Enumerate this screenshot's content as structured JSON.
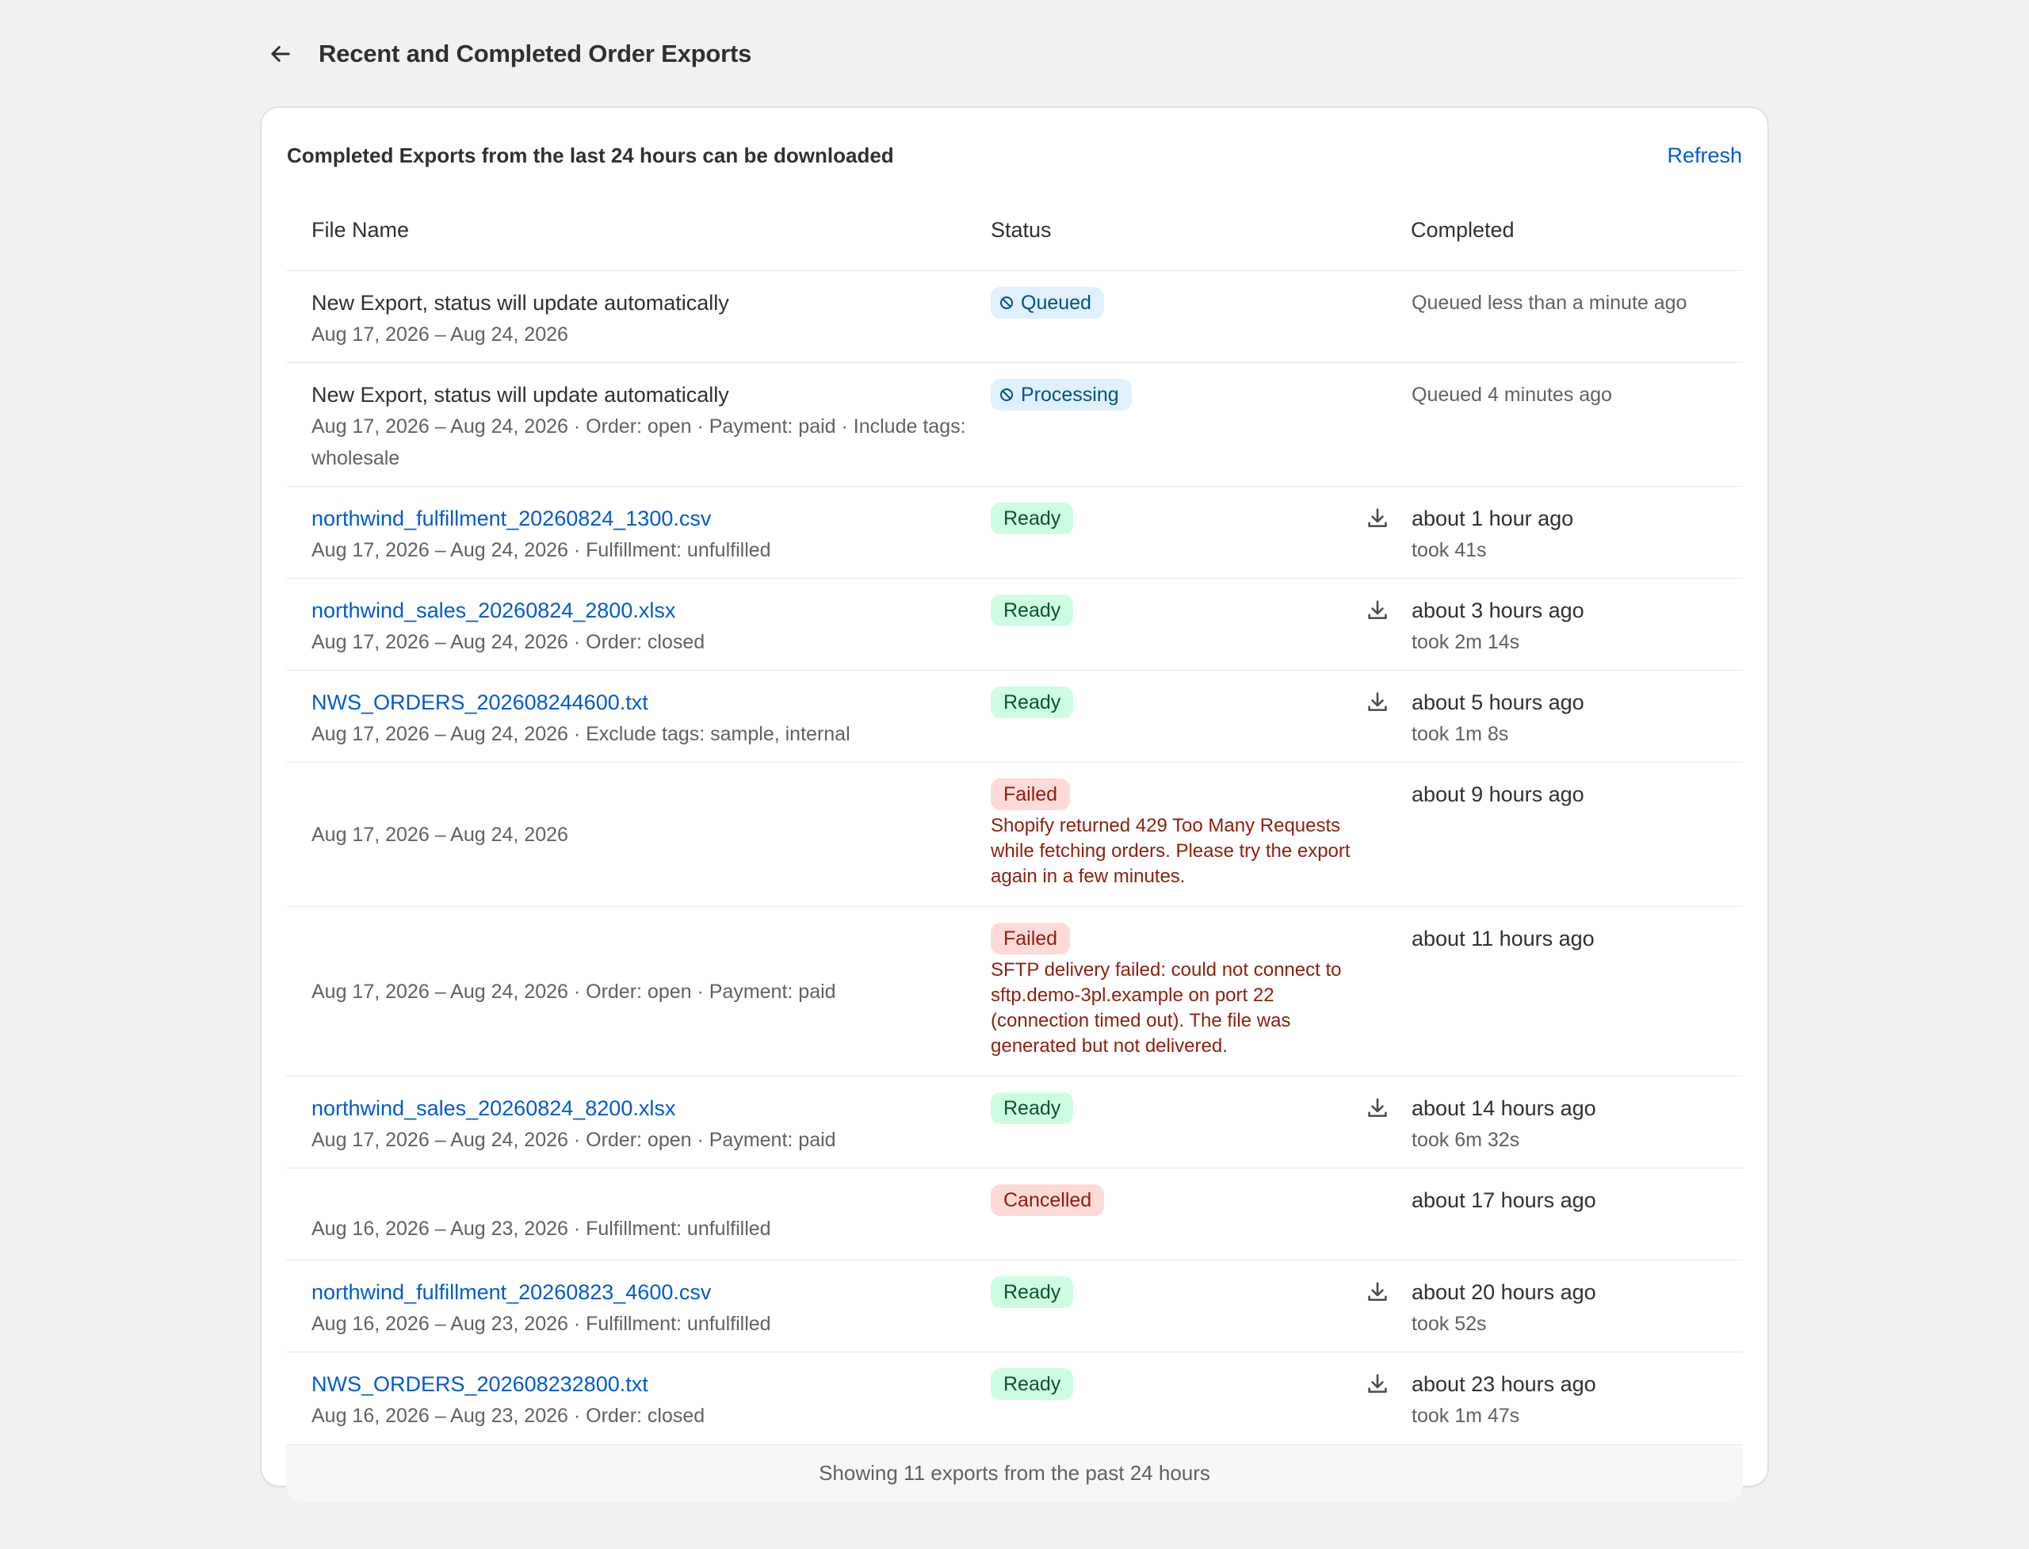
{
  "page": {
    "title": "Recent and Completed Order Exports"
  },
  "card": {
    "header_text": "Completed Exports from the last 24 hours can be downloaded",
    "refresh_label": "Refresh"
  },
  "table": {
    "columns": [
      "File Name",
      "Status",
      "Completed"
    ],
    "rows": [
      {
        "title": "New Export, status will update automatically",
        "meta": "Aug 17, 2026 – Aug 24, 2026",
        "status": "Queued",
        "completed": "Queued less than a minute ago"
      },
      {
        "title": "New Export, status will update automatically",
        "meta": "Aug 17, 2026 – Aug 24, 2026 · Order: open · Payment: paid · Include tags: wholesale",
        "status": "Processing",
        "completed": "Queued 4 minutes ago"
      },
      {
        "file": "northwind_fulfillment_20260824_1300.csv",
        "meta": "Aug 17, 2026 – Aug 24, 2026 · Fulfillment: unfulfilled",
        "status": "Ready",
        "completed": "about 1 hour ago",
        "took": "took 41s"
      },
      {
        "file": "northwind_sales_20260824_2800.xlsx",
        "meta": "Aug 17, 2026 – Aug 24, 2026 · Order: closed",
        "status": "Ready",
        "completed": "about 3 hours ago",
        "took": "took 2m 14s"
      },
      {
        "file": "NWS_ORDERS_202608244600.txt",
        "meta": "Aug 17, 2026 – Aug 24, 2026 · Exclude tags: sample, internal",
        "status": "Ready",
        "completed": "about 5 hours ago",
        "took": "took 1m 8s"
      },
      {
        "meta": "Aug 17, 2026 – Aug 24, 2026",
        "status": "Failed",
        "error": "Shopify returned 429 Too Many Requests while fetching orders. Please try the export again in a few minutes.",
        "completed": "about 9 hours ago"
      },
      {
        "meta": "Aug 17, 2026 – Aug 24, 2026 · Order: open · Payment: paid",
        "status": "Failed",
        "error": "SFTP delivery failed: could not connect to sftp.demo-3pl.example on port 22 (connection timed out). The file was generated but not delivered.",
        "completed": "about 11 hours ago"
      },
      {
        "file": "northwind_sales_20260824_8200.xlsx",
        "meta": "Aug 17, 2026 – Aug 24, 2026 · Order: open · Payment: paid",
        "status": "Ready",
        "completed": "about 14 hours ago",
        "took": "took 6m 32s"
      },
      {
        "meta": "Aug 16, 2026 – Aug 23, 2026 · Fulfillment: unfulfilled",
        "status": "Cancelled",
        "completed": "about 17 hours ago"
      },
      {
        "file": "northwind_fulfillment_20260823_4600.csv",
        "meta": "Aug 16, 2026 – Aug 23, 2026 · Fulfillment: unfulfilled",
        "status": "Ready",
        "completed": "about 20 hours ago",
        "took": "took 52s"
      },
      {
        "file": "NWS_ORDERS_202608232800.txt",
        "meta": "Aug 16, 2026 – Aug 23, 2026 · Order: closed",
        "status": "Ready",
        "completed": "about 23 hours ago",
        "took": "took 1m 47s"
      }
    ],
    "footer": "Showing 11 exports from the past 24 hours"
  },
  "colors": {
    "link": "#005bd3",
    "ready_bg": "#cdfee1",
    "ready_text": "#0c5132",
    "failed_bg": "#fedad9",
    "failed_text": "#8e1f0b",
    "queued_bg": "#e0f0ff",
    "queued_text": "#00527c"
  },
  "icons": {
    "back": "arrow-left-icon",
    "download": "download-icon",
    "pending": "circle-slash-icon"
  }
}
